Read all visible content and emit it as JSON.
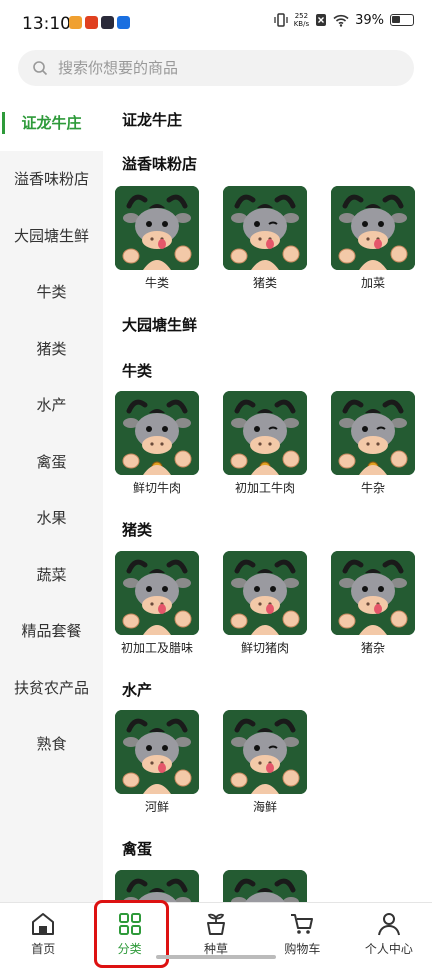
{
  "status_bar": {
    "time": "13:10",
    "speed_value": "252",
    "speed_unit": "KB/s",
    "battery": "39%"
  },
  "search": {
    "placeholder": "搜索你想要的商品"
  },
  "sidebar": {
    "items": [
      {
        "label": "证龙牛庄",
        "active": true
      },
      {
        "label": "溢香味粉店"
      },
      {
        "label": "大园塘生鲜"
      },
      {
        "label": "牛类"
      },
      {
        "label": "猪类"
      },
      {
        "label": "水产"
      },
      {
        "label": "禽蛋"
      },
      {
        "label": "水果"
      },
      {
        "label": "蔬菜"
      },
      {
        "label": "精品套餐"
      },
      {
        "label": "扶贫农产品"
      },
      {
        "label": "熟食"
      }
    ]
  },
  "content": {
    "sections": [
      {
        "title": "证龙牛庄"
      },
      {
        "title": "溢香味粉店",
        "products": [
          "牛类",
          "猪类",
          "加菜"
        ]
      },
      {
        "title": "大园塘生鲜"
      },
      {
        "title": "牛类",
        "products": [
          "鲜切牛肉",
          "初加工牛肉",
          "牛杂"
        ]
      },
      {
        "title": "猪类",
        "products": [
          "初加工及腊味",
          "鲜切猪肉",
          "猪杂"
        ]
      },
      {
        "title": "水产",
        "products": [
          "河鲜",
          "海鲜"
        ]
      },
      {
        "title": "禽蛋"
      }
    ]
  },
  "bottom_nav": {
    "items": [
      {
        "label": "首页",
        "icon": "home-icon"
      },
      {
        "label": "分类",
        "icon": "category-icon",
        "active": true
      },
      {
        "label": "种草",
        "icon": "plant-pot-icon"
      },
      {
        "label": "购物车",
        "icon": "cart-icon"
      },
      {
        "label": "个人中心",
        "icon": "person-icon"
      }
    ]
  },
  "colors": {
    "accent": "#2e9a3a",
    "tile_bg": "#245b32",
    "highlight_box": "#dd1111"
  }
}
